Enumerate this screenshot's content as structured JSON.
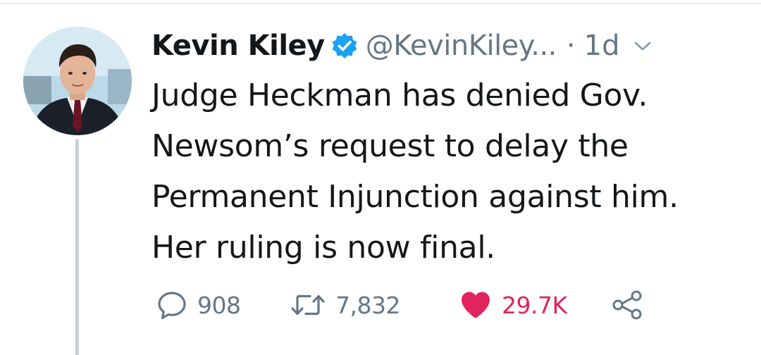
{
  "tweet": {
    "author_name": "Kevin Kiley",
    "handle": "@KevinKiley...",
    "separator": "·",
    "time": "1d",
    "text_lines": [
      "Judge Heckman has denied Gov.",
      "Newsom’s request to delay the",
      "Permanent Injunction against him.",
      "Her ruling is now final."
    ],
    "verified": true
  },
  "actions": {
    "reply_count": "908",
    "retweet_count": "7,832",
    "like_count": "29.7K",
    "liked": true
  },
  "colors": {
    "text_primary": "#14171a",
    "text_secondary": "#657786",
    "verified_blue": "#1da1f2",
    "like_red": "#e0245e",
    "thread_line": "#c7d2da",
    "divider": "#e6ecf0"
  },
  "icons": {
    "verified": "verified-badge-icon",
    "menu": "chevron-down-icon",
    "reply": "reply-bubble-icon",
    "retweet": "retweet-arrows-icon",
    "like": "heart-icon",
    "share": "share-nodes-icon"
  }
}
